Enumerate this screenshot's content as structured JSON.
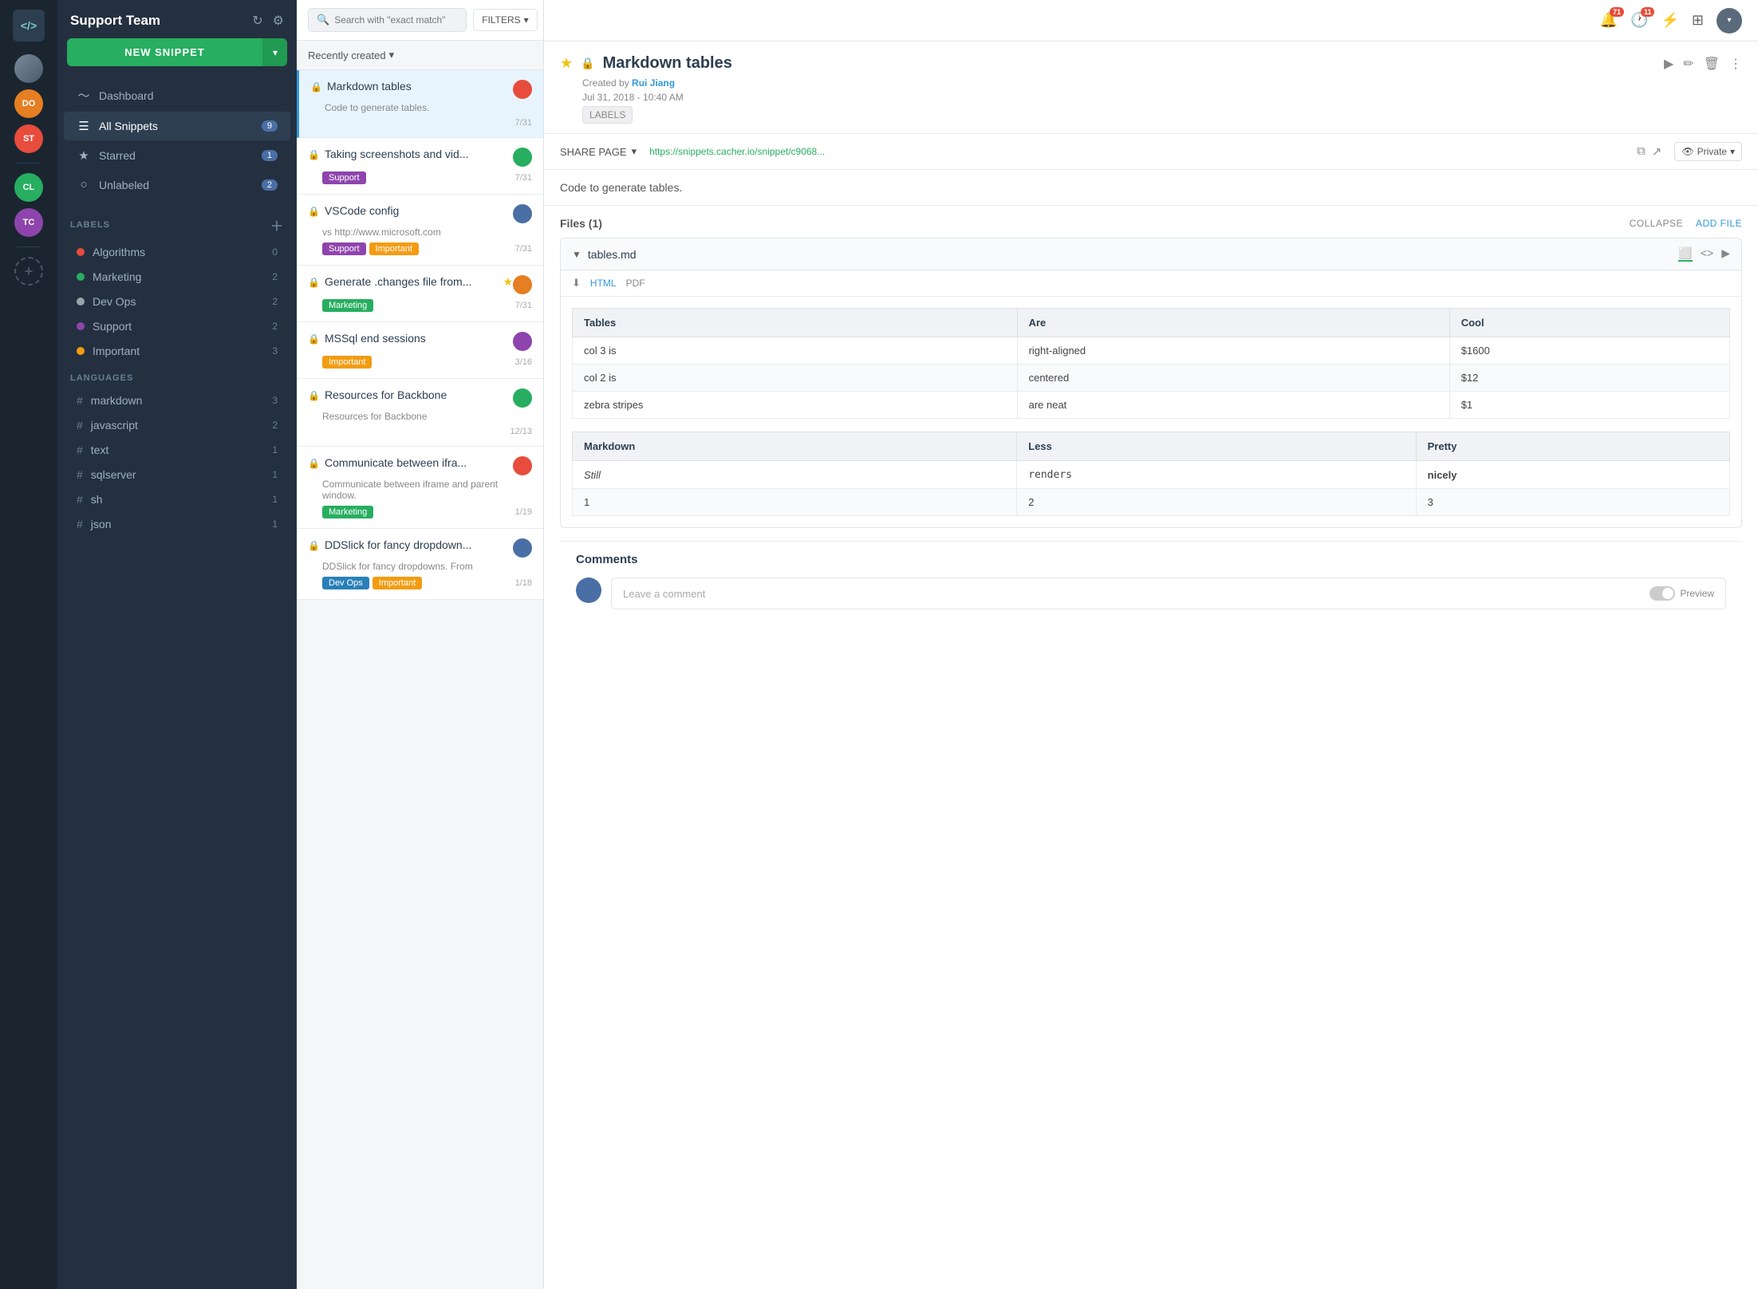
{
  "iconBar": {
    "logo": "</>",
    "avatars": [
      {
        "id": "main",
        "initials": "",
        "color": "#4a6fa5"
      },
      {
        "id": "do",
        "initials": "DO",
        "color": "#e67e22"
      },
      {
        "id": "st",
        "initials": "ST",
        "color": "#e74c3c"
      },
      {
        "id": "cl",
        "initials": "CL",
        "color": "#27ae60"
      },
      {
        "id": "tc",
        "initials": "TC",
        "color": "#8e44ad"
      }
    ]
  },
  "sidebar": {
    "teamName": "Support Team",
    "newSnippetLabel": "NEW SNIPPET",
    "nav": [
      {
        "icon": "📊",
        "label": "Dashboard",
        "count": null,
        "active": false
      },
      {
        "icon": "☰",
        "label": "All Snippets",
        "count": "9",
        "active": true
      },
      {
        "icon": "★",
        "label": "Starred",
        "count": "1",
        "active": false
      },
      {
        "icon": "○",
        "label": "Unlabeled",
        "count": "2",
        "active": false
      }
    ],
    "labelsHeader": "LABELS",
    "labels": [
      {
        "name": "Algorithms",
        "color": "#e74c3c",
        "count": "0"
      },
      {
        "name": "Marketing",
        "color": "#27ae60",
        "count": "2"
      },
      {
        "name": "Dev Ops",
        "color": "#95a5a6",
        "count": "2"
      },
      {
        "name": "Support",
        "color": "#8e44ad",
        "count": "2"
      },
      {
        "name": "Important",
        "color": "#f39c12",
        "count": "3"
      }
    ],
    "languagesHeader": "LANGUAGES",
    "languages": [
      {
        "name": "markdown",
        "count": "3"
      },
      {
        "name": "javascript",
        "count": "2"
      },
      {
        "name": "text",
        "count": "1"
      },
      {
        "name": "sqlserver",
        "count": "1"
      },
      {
        "name": "sh",
        "count": "1"
      },
      {
        "name": "json",
        "count": "1"
      }
    ]
  },
  "snippetList": {
    "searchPlaceholder": "Search with \"exact match\"",
    "filtersLabel": "FILTERS",
    "sortLabel": "Recently created",
    "snippets": [
      {
        "id": 1,
        "title": "Markdown tables",
        "desc": "Code to generate tables.",
        "date": "7/31",
        "tags": [],
        "starred": false,
        "active": true,
        "avatarColor": "#e74c3c"
      },
      {
        "id": 2,
        "title": "Taking screenshots and vid...",
        "desc": "",
        "date": "7/31",
        "tags": [
          "Support"
        ],
        "starred": false,
        "active": false,
        "avatarColor": "#27ae60"
      },
      {
        "id": 3,
        "title": "VSCode config",
        "desc": "vs http://www.microsoft.com",
        "date": "7/31",
        "tags": [
          "Support",
          "Important"
        ],
        "starred": false,
        "active": false,
        "avatarColor": "#4a6fa5"
      },
      {
        "id": 4,
        "title": "Generate .changes file from...",
        "desc": "",
        "date": "7/31",
        "tags": [
          "Marketing"
        ],
        "starred": true,
        "active": false,
        "avatarColor": "#e67e22"
      },
      {
        "id": 5,
        "title": "MSSql end sessions",
        "desc": "",
        "date": "3/16",
        "tags": [
          "Important"
        ],
        "starred": false,
        "active": false,
        "avatarColor": "#8e44ad"
      },
      {
        "id": 6,
        "title": "Resources for Backbone",
        "desc": "Resources for Backbone",
        "date": "12/13",
        "tags": [],
        "starred": false,
        "active": false,
        "avatarColor": "#27ae60"
      },
      {
        "id": 7,
        "title": "Communicate between ifra...",
        "desc": "Communicate between iframe and parent window.",
        "date": "1/19",
        "tags": [
          "Marketing"
        ],
        "starred": false,
        "active": false,
        "avatarColor": "#e74c3c"
      },
      {
        "id": 8,
        "title": "DDSlick for fancy dropdown...",
        "desc": "DDSlick for fancy dropdowns. From",
        "date": "1/18",
        "tags": [
          "Dev Ops",
          "Important"
        ],
        "starred": false,
        "active": false,
        "avatarColor": "#4a6fa5"
      }
    ]
  },
  "detail": {
    "title": "Markdown tables",
    "createdBy": "Rui Jiang",
    "dateTime": "Jul 31, 2018 - 10:40 AM",
    "description": "Code to generate tables.",
    "labelsBtn": "LABELS",
    "sharePageLabel": "SHARE PAGE",
    "shareUrl": "https://snippets.cacher.io/snippet/c9068...",
    "privateLabel": "Private",
    "filesSection": {
      "title": "Files (1)",
      "collapseBtn": "COLLAPSE",
      "addFileBtn": "ADD FILE",
      "file": {
        "name": "tables.md",
        "downloadLabel": "Download",
        "htmlLabel": "HTML",
        "pdfLabel": "PDF",
        "table1": {
          "headers": [
            "Tables",
            "Are",
            "Cool"
          ],
          "rows": [
            [
              "col 3 is",
              "right-aligned",
              "$1600"
            ],
            [
              "col 2 is",
              "centered",
              "$12"
            ],
            [
              "zebra stripes",
              "are neat",
              "$1"
            ]
          ]
        },
        "table2": {
          "headers": [
            "Markdown",
            "Less",
            "Pretty"
          ],
          "rows": [
            [
              "Still",
              "renders",
              "nicely"
            ],
            [
              "1",
              "2",
              "3"
            ]
          ]
        }
      }
    },
    "comments": {
      "title": "Comments",
      "placeholder": "Leave a comment",
      "previewLabel": "Preview"
    }
  },
  "topBar": {
    "badge71": "71",
    "badge11": "11"
  }
}
